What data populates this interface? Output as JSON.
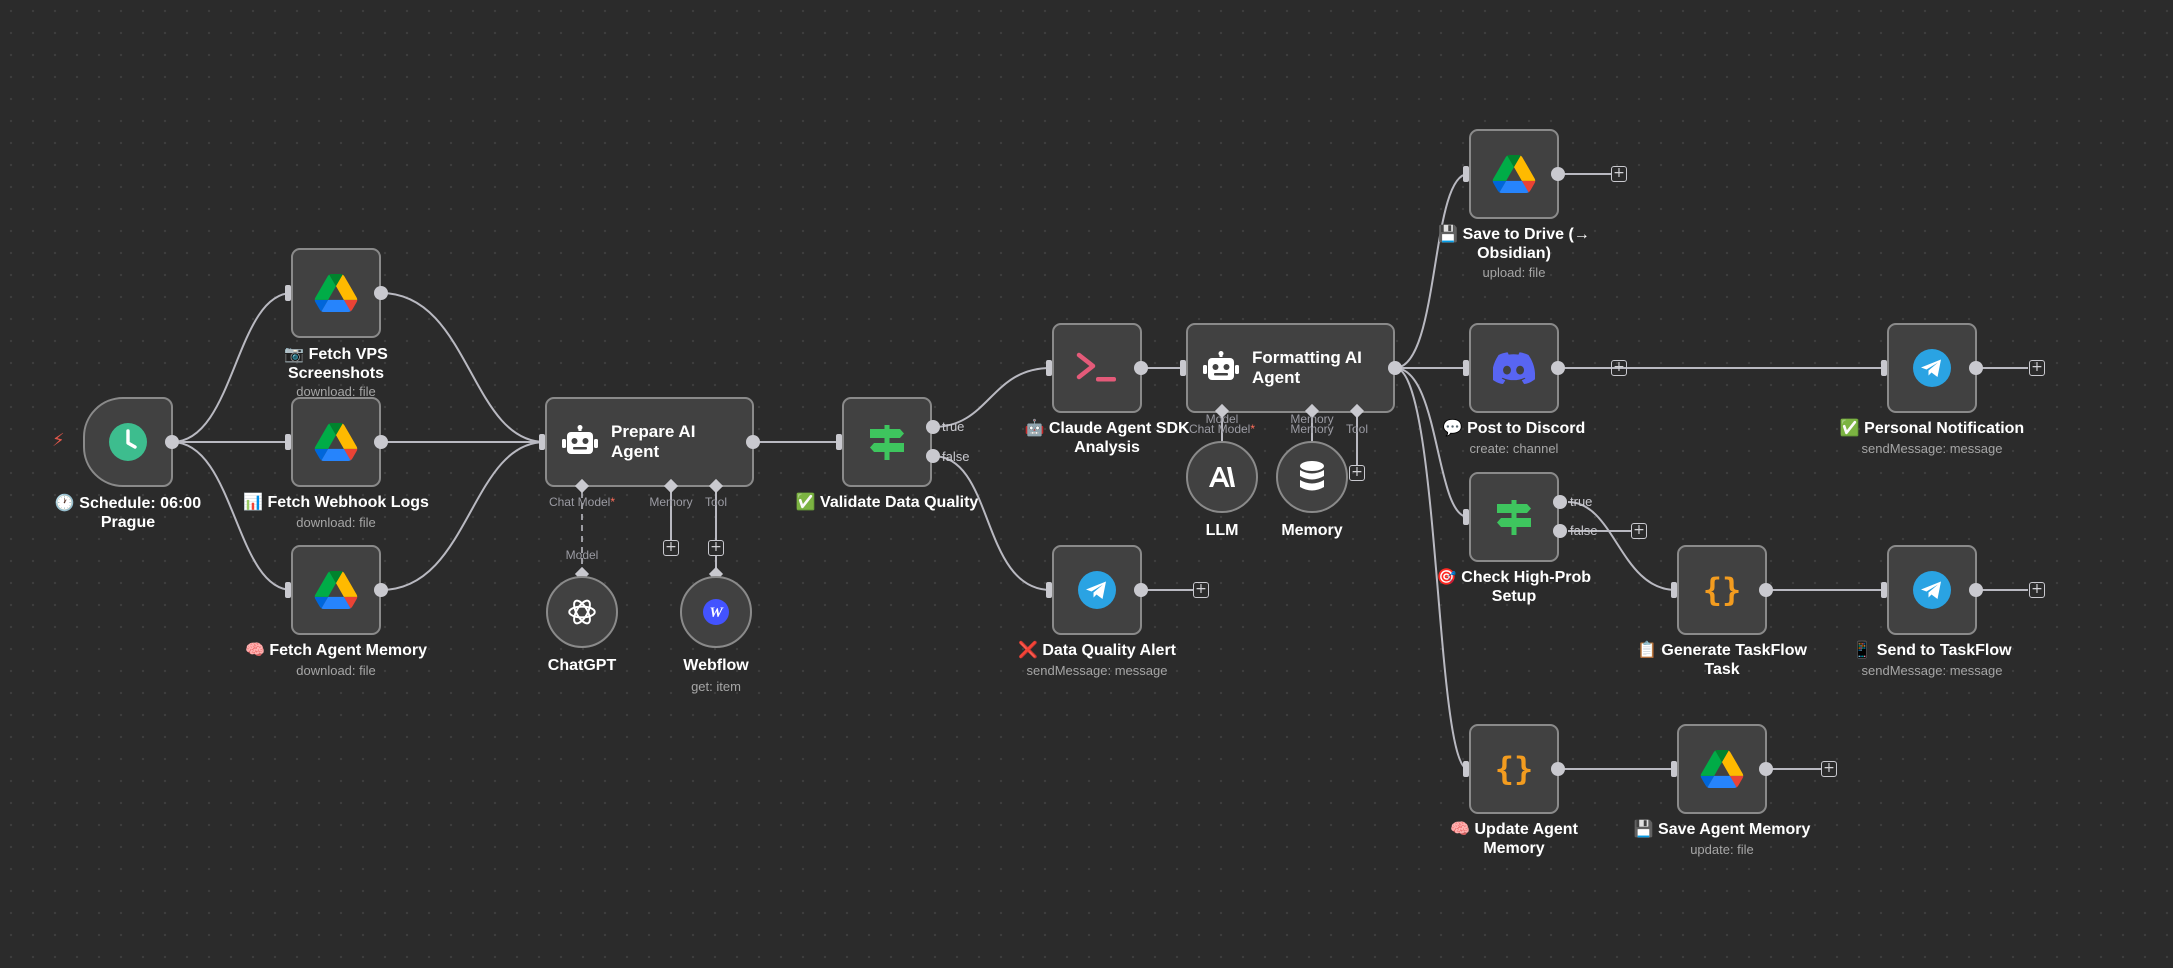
{
  "trigger_marker": "⚡",
  "nodes": {
    "schedule": {
      "emoji": "🕐",
      "title_l1": "Schedule: 06:00",
      "title_l2": "Prague"
    },
    "fetch_vps": {
      "emoji": "📷",
      "title_l1": "Fetch VPS",
      "title_l2": "Screenshots",
      "subtitle": "download: file"
    },
    "fetch_webhook": {
      "emoji": "📊",
      "title": "Fetch Webhook Logs",
      "subtitle": "download: file"
    },
    "fetch_memory": {
      "emoji": "🧠",
      "title": "Fetch Agent Memory",
      "subtitle": "download: file"
    },
    "prepare_agent": {
      "title": "Prepare AI Agent",
      "slots": [
        "Chat Model",
        "Memory",
        "Tool"
      ],
      "required_mark": "*"
    },
    "chatgpt": {
      "title": "ChatGPT",
      "connector": "Model"
    },
    "webflow": {
      "title": "Webflow",
      "subtitle": "get: item"
    },
    "validate": {
      "emoji": "✅",
      "title": "Validate Data Quality",
      "branch_true": "true",
      "branch_false": "false"
    },
    "claude_sdk": {
      "emoji": "🤖",
      "title_l1": "Claude Agent SDK",
      "title_l2": "Analysis"
    },
    "data_alert": {
      "emoji": "❌",
      "title": "Data Quality Alert",
      "subtitle": "sendMessage: message"
    },
    "formatting_agent": {
      "title_l1": "Formatting AI",
      "title_l2": "Agent",
      "slot_top": [
        "Model",
        "Memory"
      ],
      "slots": [
        "Chat Model",
        "Memory",
        "Tool"
      ],
      "required_mark": "*"
    },
    "llm": {
      "title": "LLM"
    },
    "memory": {
      "title": "Memory"
    },
    "save_drive": {
      "emoji": "💾",
      "title_l1": "Save to Drive (→",
      "title_l2": "Obsidian)",
      "subtitle": "upload: file"
    },
    "discord": {
      "emoji": "💬",
      "title": "Post to Discord",
      "subtitle": "create: channel"
    },
    "personal_notify": {
      "emoji": "✅",
      "title": "Personal Notification",
      "subtitle": "sendMessage: message"
    },
    "check_high": {
      "emoji": "🎯",
      "title_l1": "Check High-Prob",
      "title_l2": "Setup",
      "branch_true": "true",
      "branch_false": "false"
    },
    "gen_taskflow": {
      "emoji": "📋",
      "title_l1": "Generate TaskFlow",
      "title_l2": "Task"
    },
    "send_taskflow": {
      "emoji": "📱",
      "title": "Send to TaskFlow",
      "subtitle": "sendMessage: message"
    },
    "update_memory": {
      "emoji": "🧠",
      "title_l1": "Update Agent",
      "title_l2": "Memory"
    },
    "save_memory": {
      "emoji": "💾",
      "title": "Save Agent Memory",
      "subtitle": "update: file"
    }
  },
  "colors": {
    "canvas": "#2b2b2b",
    "node_bg": "#414141",
    "node_border": "#8a8a8a",
    "edge": "#b9b9c1",
    "clock": "#3dbd8e",
    "if_green": "#3ec55e",
    "code_orange": "#f39c1f",
    "telegram": "#2aa3e3",
    "discord": "#5865f2",
    "terminal_pink": "#e45a79",
    "webflow": "#4353ff"
  },
  "icons": {
    "schedule": "clock-icon",
    "drive": "google-drive-icon",
    "agent": "robot-icon",
    "if": "signpost-icon",
    "terminal": "terminal-icon",
    "telegram": "telegram-icon",
    "discord": "discord-icon",
    "code": "braces-icon",
    "openai": "openai-icon",
    "anthropic": "anthropic-icon",
    "database": "database-icon",
    "webflow": "webflow-icon",
    "add": "plus-icon"
  }
}
